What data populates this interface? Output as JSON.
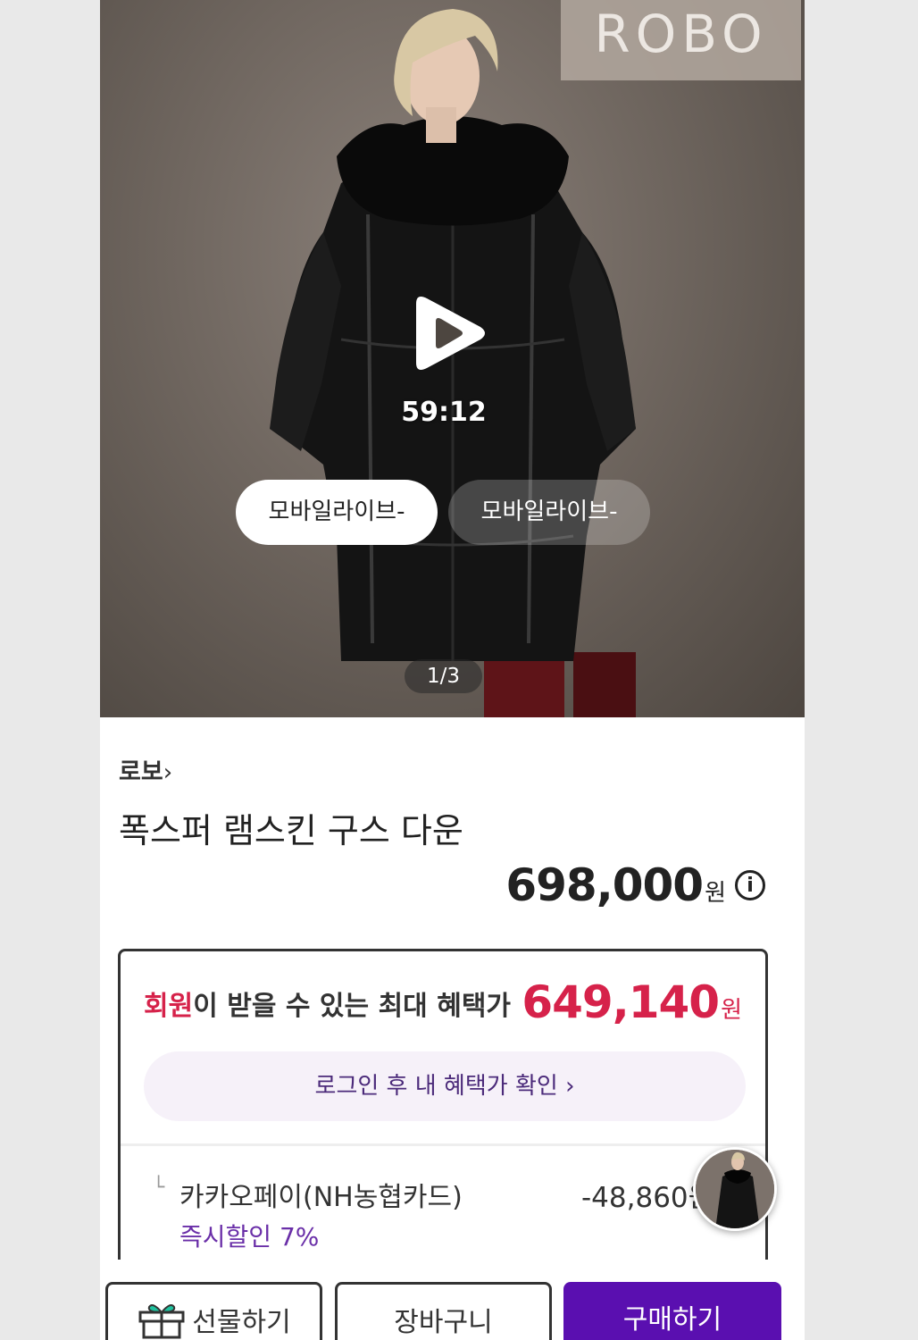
{
  "hero": {
    "brand_watermark": "ROBO",
    "video_time": "59:12",
    "chips": [
      "모바일라이브-",
      "모바일라이브-"
    ],
    "pager": "1/3"
  },
  "product": {
    "brand": "로보",
    "title": "폭스퍼 램스킨 구스 다운",
    "price": "698,000",
    "price_unit": "원"
  },
  "benefit": {
    "head_accent": "회원",
    "head_rest": "이 받을 수 있는 최대 혜택가",
    "price": "649,140",
    "price_unit": "원",
    "login_label": "로그인 후 내 혜택가 확인",
    "discount_label": "카카오페이(NH농협카드)",
    "discount_sub": "즉시할인 7%",
    "discount_amount": "-48,860원"
  },
  "bottom_bar": {
    "gift_label": "선물하기",
    "cart_label": "장바구니",
    "buy_label": "구매하기"
  },
  "colors": {
    "accent_red": "#d6224a",
    "accent_purple": "#5a0fb0",
    "benefit_bg": "#f6f1f9"
  }
}
